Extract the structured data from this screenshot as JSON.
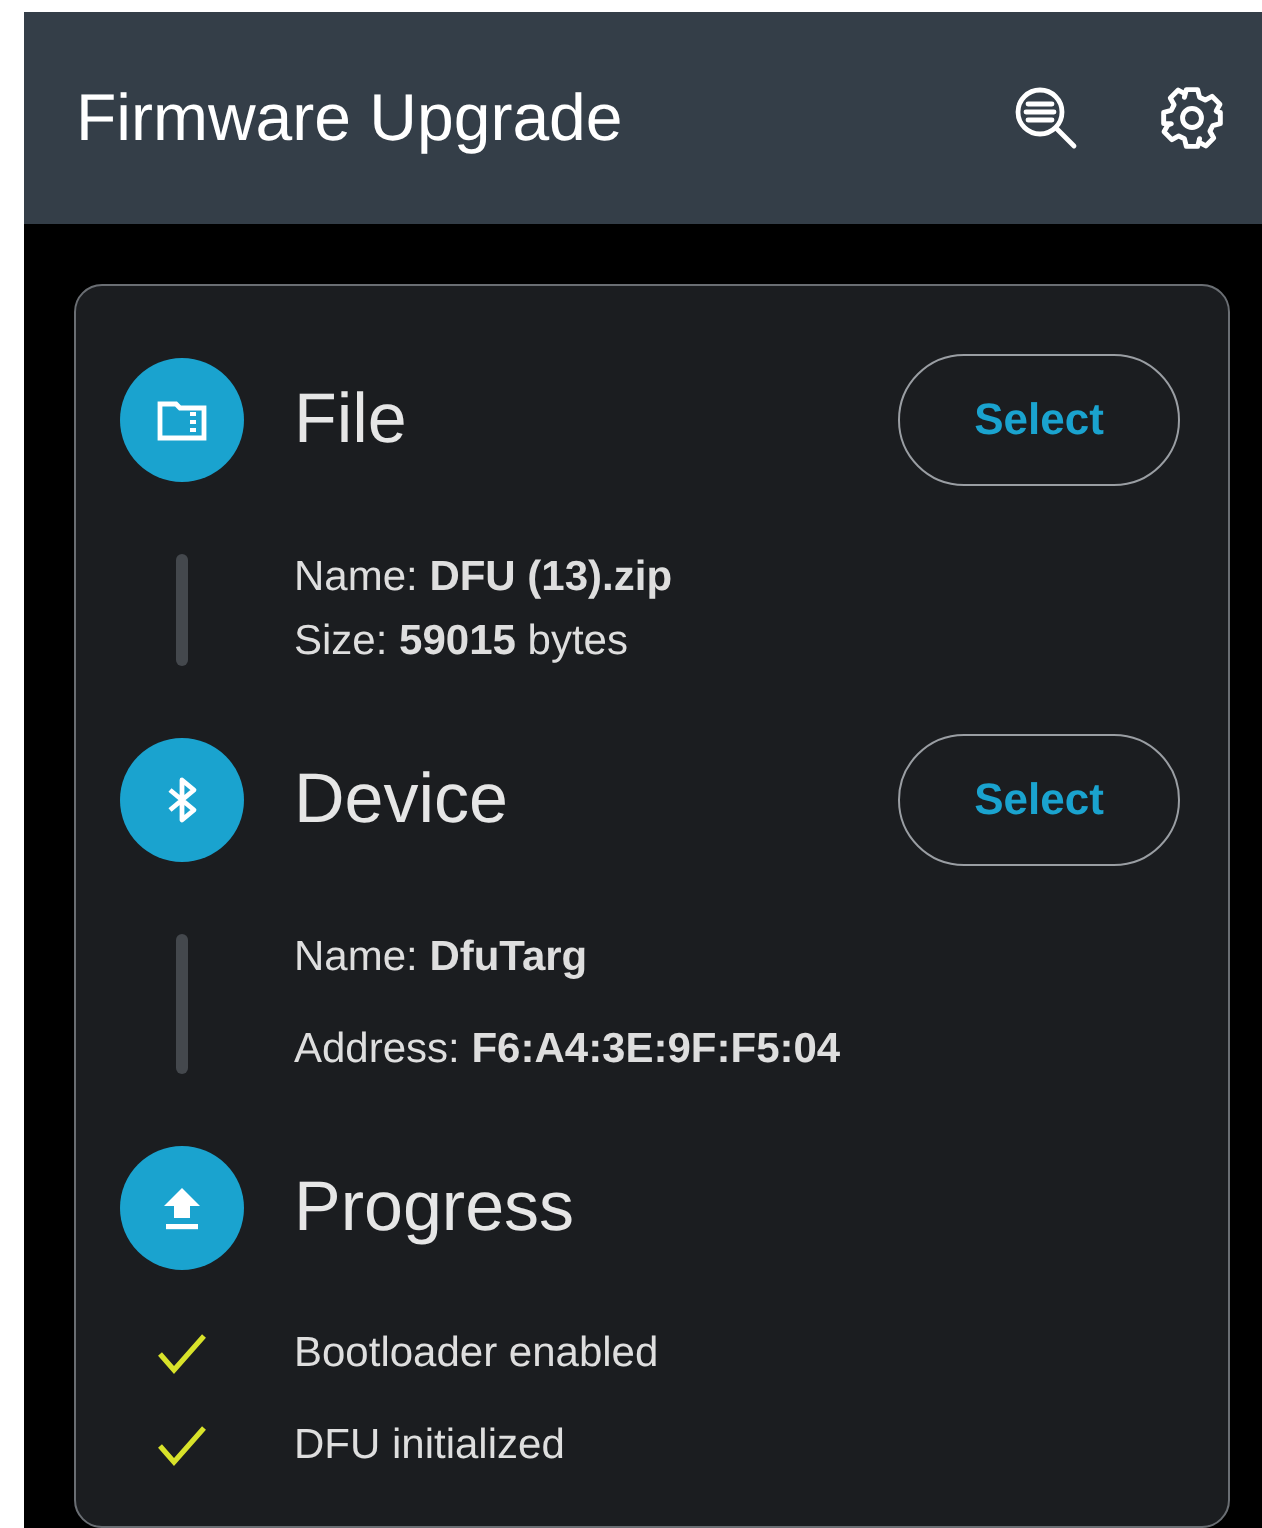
{
  "app_bar": {
    "title": "Firmware Upgrade"
  },
  "sections": [
    {
      "kind": "file",
      "title": "File",
      "button": "Select",
      "details": [
        "Name: **DFU (13).zip**",
        "Size: **59015** bytes"
      ]
    },
    {
      "kind": "device",
      "title": "Device",
      "button": "Select",
      "details": [
        "Name: **DfuTarg**",
        "Address: **F6:A4:3E:9F:F5:04**"
      ]
    },
    {
      "kind": "progress",
      "title": "Progress",
      "steps": [
        {
          "label": "Bootloader enabled",
          "completed": true
        },
        {
          "label": "DFU initialized",
          "completed": true
        }
      ]
    }
  ]
}
